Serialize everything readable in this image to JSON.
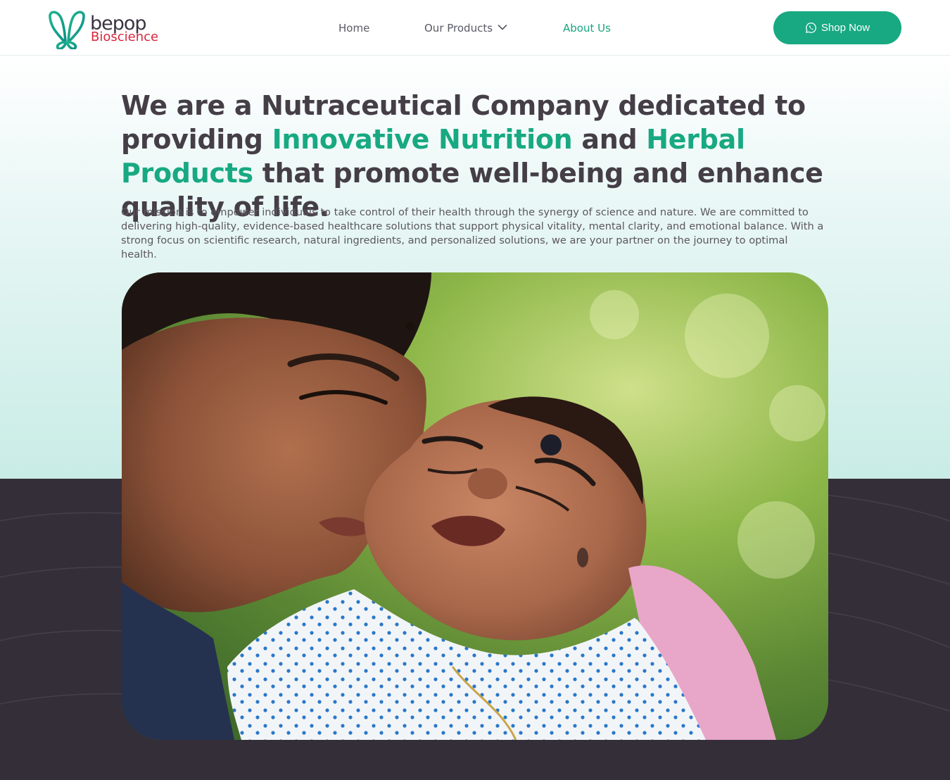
{
  "brand": {
    "name": "bepop",
    "sub": "Bioscience",
    "logo_icon": "butterfly-logo-icon",
    "colors": {
      "primary": "#18a982",
      "brand_red": "#d7263d",
      "text_dark": "#453e47",
      "dark_band": "#342e39"
    }
  },
  "nav": {
    "home": "Home",
    "products": "Our Products",
    "about": "About Us",
    "active": "About Us"
  },
  "cta": {
    "shop_label": "Shop Now",
    "icon": "whatsapp-icon"
  },
  "hero": {
    "headline_part1": "We are a Nutraceutical Company dedicated to providing ",
    "highlight1": "Innovative Nutrition",
    "headline_part2": " and ",
    "highlight2": "Herbal Products",
    "headline_part3": " that promote well-being and enhance quality of life.",
    "mission": "Our mission is to empower individuals to take control of their health through the synergy of science and nature. We are committed to delivering high-quality, evidence-based healthcare solutions that support physical vitality, mental clarity, and emotional balance. With a strong focus on scientific research, natural ingredients, and personalized solutions, we are your partner on the journey to optimal health."
  }
}
